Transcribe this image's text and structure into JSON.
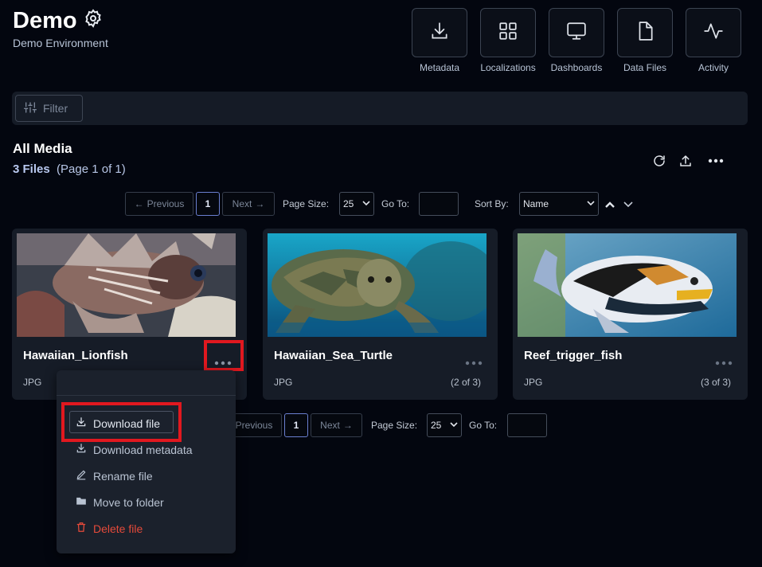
{
  "header": {
    "title": "Demo",
    "subtitle": "Demo Environment",
    "nav": [
      {
        "label": "Metadata",
        "icon": "download-icon"
      },
      {
        "label": "Localizations",
        "icon": "grid-icon"
      },
      {
        "label": "Dashboards",
        "icon": "monitor-icon"
      },
      {
        "label": "Data Files",
        "icon": "file-icon"
      },
      {
        "label": "Activity",
        "icon": "activity-icon"
      }
    ]
  },
  "filter": {
    "label": "Filter"
  },
  "section": {
    "title": "All Media",
    "count": "3 Files",
    "page_info": "(Page 1 of 1)"
  },
  "pagination": {
    "previous": "Previous",
    "page": "1",
    "next": "Next",
    "page_size_label": "Page Size:",
    "page_size": "25",
    "goto_label": "Go To:",
    "sort_label": "Sort By:",
    "sort_value": "Name"
  },
  "cards": [
    {
      "name": "Hawaiian_Lionfish",
      "type": "JPG",
      "position": ""
    },
    {
      "name": "Hawaiian_Sea_Turtle",
      "type": "JPG",
      "position": "(2 of 3)"
    },
    {
      "name": "Reef_trigger_fish",
      "type": "JPG",
      "position": "(3 of 3)"
    }
  ],
  "menu": {
    "items": [
      {
        "label": "Download file",
        "icon": "download-icon"
      },
      {
        "label": "Download metadata",
        "icon": "download-icon"
      },
      {
        "label": "Rename file",
        "icon": "pencil-icon"
      },
      {
        "label": "Move to folder",
        "icon": "folder-icon"
      },
      {
        "label": "Delete file",
        "icon": "trash-icon"
      }
    ]
  },
  "colors": {
    "background": "#03060f",
    "highlight": "#e1181f",
    "danger": "#e54a3a",
    "accent": "#6a7fd0"
  }
}
